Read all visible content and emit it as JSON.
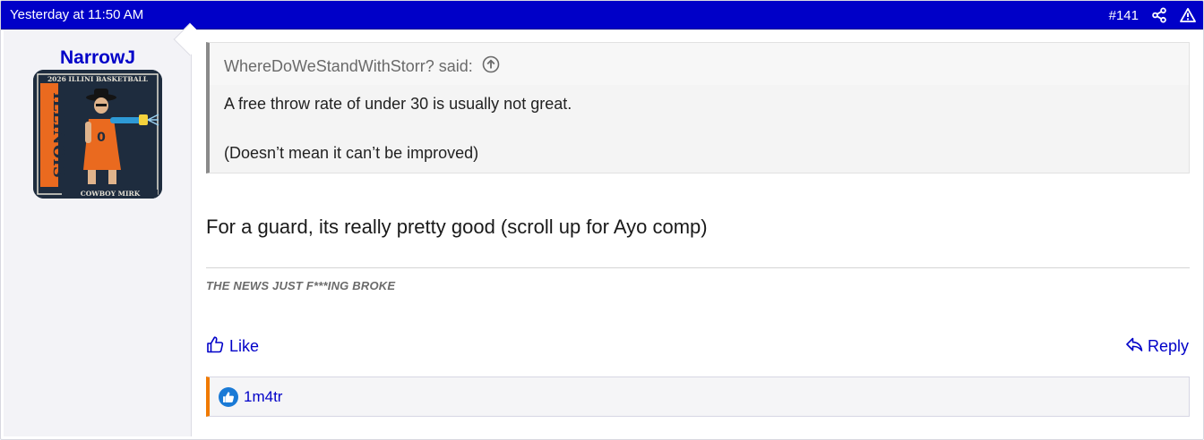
{
  "header": {
    "date": "Yesterday at 11:50 AM",
    "post_number": "#141",
    "share_icon": "share-icon",
    "report_icon": "warning-triangle-icon",
    "background": "#0000c8"
  },
  "author": {
    "username": "NarrowJ",
    "avatar": {
      "top_text": "2026 ILLINI BASKETBALL",
      "side_text": "ILLINOIS",
      "bottom_text": "COWBOY MIRK",
      "jersey_number": "0"
    }
  },
  "quote": {
    "author": "WhereDoWeStandWithStorr? said:",
    "jump_icon": "arrow-up-circle-icon",
    "lines": [
      "A free throw rate of under 30 is usually not great.",
      "(Doesn’t mean it can’t be improved)"
    ]
  },
  "message": {
    "text": "For a guard, its really pretty good (scroll up for Ayo comp)"
  },
  "signature": {
    "text": "THE NEWS JUST F***ING BROKE"
  },
  "actions": {
    "like_label": "Like",
    "like_icon": "thumbs-up-icon",
    "reply_label": "Reply",
    "reply_icon": "reply-arrow-icon",
    "link_color": "#0000c8"
  },
  "reactions": {
    "icon": "like-reaction-icon",
    "users": "1m4tr",
    "accent": "#f07a00"
  }
}
